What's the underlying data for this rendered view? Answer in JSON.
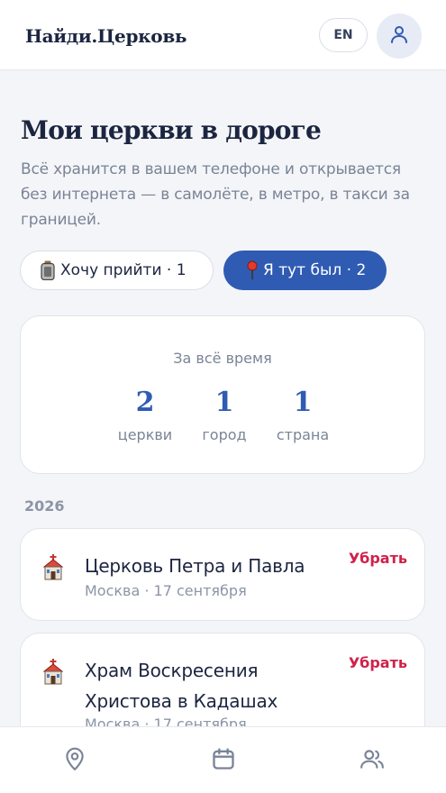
{
  "header": {
    "logo": "Найди.Церковь",
    "lang_button": "EN",
    "profile_icon": "user-icon"
  },
  "page": {
    "title": "Мои церкви в дороге",
    "subtitle": "Всё хранится в вашем телефоне и открывается без интернета — в самолёте, в метро, в такси за границей."
  },
  "tabs": [
    {
      "icon": "bag-icon",
      "label": "Хочу прийти · 1",
      "active": false
    },
    {
      "icon": "pin-icon",
      "label": "Я тут был · 2",
      "active": true
    }
  ],
  "stats": {
    "caption": "За всё время",
    "items": [
      {
        "value": "2",
        "label": "церкви"
      },
      {
        "value": "1",
        "label": "город"
      },
      {
        "value": "1",
        "label": "страна"
      }
    ]
  },
  "year_group": "2026",
  "churches": [
    {
      "name": "Церковь Петра и Павла",
      "meta": "Москва · 17 сентября",
      "remove_label": "Убрать",
      "icon": "church-icon"
    },
    {
      "name": "Храм Воскресения Христова в Кадашах",
      "meta": "Москва · 17 сентября",
      "remove_label": "Убрать",
      "icon": "church-icon"
    }
  ],
  "bottom_nav": [
    {
      "icon": "map-pin-icon"
    },
    {
      "icon": "calendar-icon"
    },
    {
      "icon": "users-icon"
    }
  ],
  "colors": {
    "accent": "#2f5bb3",
    "danger": "#d0214a",
    "text": "#1c2540",
    "muted": "#7a8497",
    "background": "#f4f5f8"
  }
}
